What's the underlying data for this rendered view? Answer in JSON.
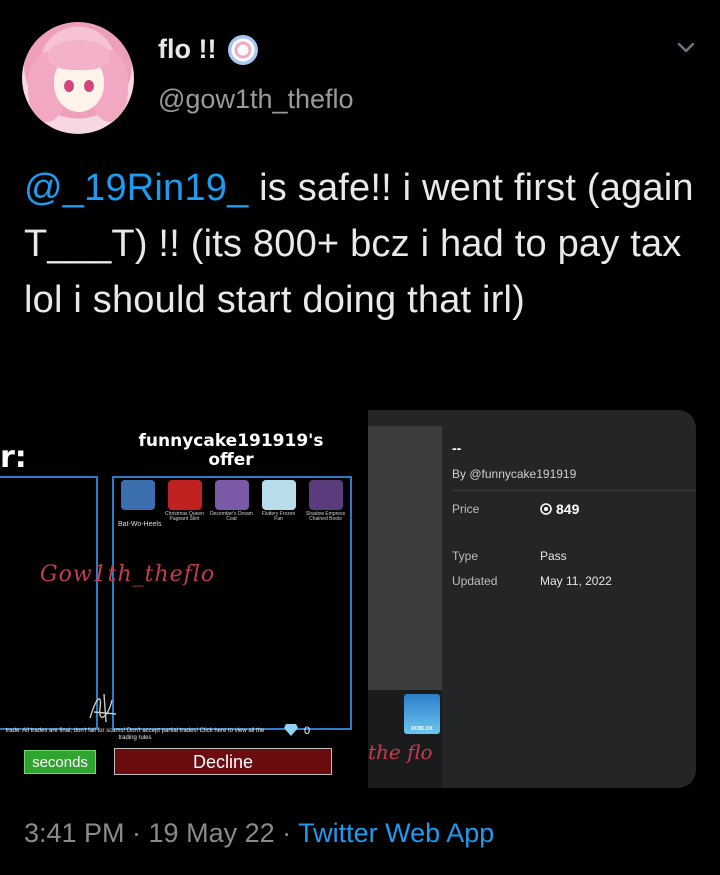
{
  "user": {
    "display_name": "flo !!",
    "handle": "@gow1th_theflo"
  },
  "tweet": {
    "mention": "@_19Rin19_",
    "text": " is safe!! i went first (again T___T) !! (its 800+ bcz i had to pay tax lol i should start doing that irl)"
  },
  "trade_screenshot": {
    "partial_heading": "r:",
    "offer_title": "funnycake191919's offer",
    "items": [
      {
        "name": "Bat-Wo-Heels",
        "color": "#3b6fb0"
      },
      {
        "name": "Christmas Queen Pageant Skirt",
        "color": "#c02222"
      },
      {
        "name": "December's Dream Coat",
        "color": "#7a5aa6"
      },
      {
        "name": "Fluttery Frozen Fan",
        "color": "#b9dceb"
      },
      {
        "name": "Shadow Empress Chained Boots",
        "color": "#5a3b7c"
      }
    ],
    "side_label": "Bat-Wo-Heels",
    "scribble_name": "Gow1th_theflo",
    "warning": "trade. All trades are final, don't fall for scams! Don't accept partial trades! Click here to view all the trading rules",
    "gem_count": "0",
    "seconds_label": "seconds",
    "decline_label": "Decline"
  },
  "pass_screenshot": {
    "title": "--",
    "by": "By @funnycake191919",
    "price_label": "Price",
    "price_value": "849",
    "type_label": "Type",
    "type_value": "Pass",
    "updated_label": "Updated",
    "updated_value": "May 11, 2022",
    "roblox_label": "ROBLOX",
    "scribble": "the flo"
  },
  "footer": {
    "time": "3:41 PM · 19 May 22 · ",
    "app": "Twitter Web App"
  },
  "colors": {
    "accent": "#1d9bf0",
    "background": "#000000",
    "panel_border": "#2d7cc8",
    "decline": "#6a0c10",
    "seconds": "#2fa52f"
  }
}
